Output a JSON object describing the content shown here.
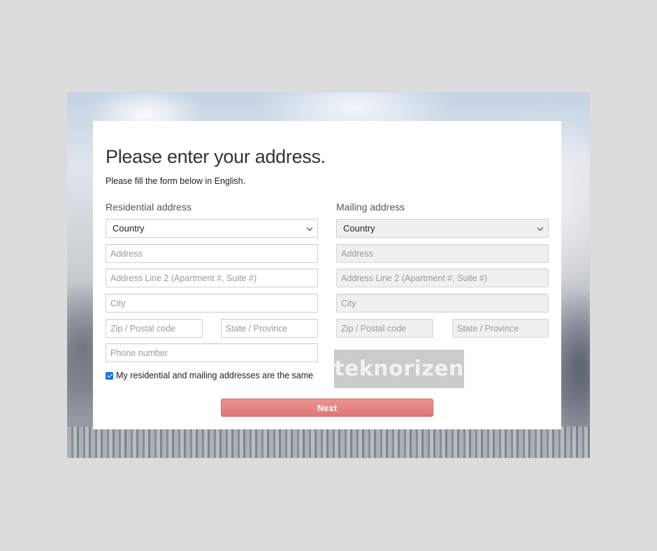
{
  "page": {
    "title": "Please enter your address.",
    "subtitle": "Please fill the form below in English."
  },
  "residential": {
    "label": "Residential address",
    "country": "Country",
    "address_placeholder": "Address",
    "address2_placeholder": "Address Line 2 (Apartment #, Suite #)",
    "city_placeholder": "City",
    "zip_placeholder": "Zip / Postal code",
    "state_placeholder": "State / Province",
    "phone_placeholder": "Phone number"
  },
  "mailing": {
    "label": "Mailing address",
    "country": "Country",
    "address_placeholder": "Address",
    "address2_placeholder": "Address Line 2 (Apartment #, Suite #)",
    "city_placeholder": "City",
    "zip_placeholder": "Zip / Postal code",
    "state_placeholder": "State / Province",
    "disabled": true
  },
  "same_address": {
    "label": "My residential and mailing addresses are the same",
    "checked": true
  },
  "watermark": "teknorizen",
  "next_button": "Next",
  "colors": {
    "accent": "#e27d7d",
    "checkbox": "#1a73e8"
  }
}
